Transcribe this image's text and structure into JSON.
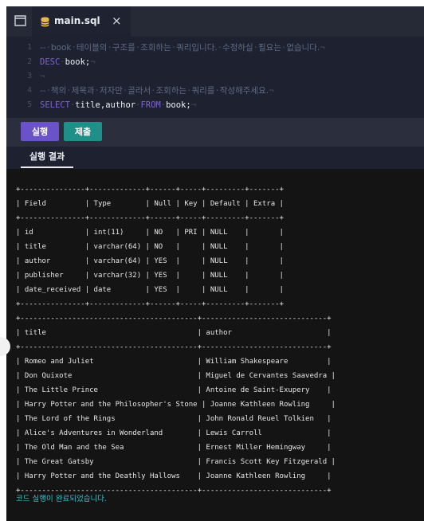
{
  "tab": {
    "filename": "main.sql",
    "close_glyph": "×"
  },
  "icons": {
    "files": "files-icon",
    "database": "database-icon",
    "close": "close-icon"
  },
  "editor": {
    "lines": [
      {
        "num": "1",
        "parts": [
          {
            "t": "--",
            "c": "cm"
          },
          {
            "t": "·",
            "c": "ws"
          },
          {
            "t": "book",
            "c": "cm"
          },
          {
            "t": "·",
            "c": "ws"
          },
          {
            "t": "테이블의",
            "c": "cm"
          },
          {
            "t": "·",
            "c": "ws"
          },
          {
            "t": "구조를",
            "c": "cm"
          },
          {
            "t": "·",
            "c": "ws"
          },
          {
            "t": "조회하는",
            "c": "cm"
          },
          {
            "t": "·",
            "c": "ws"
          },
          {
            "t": "쿼리입니다.",
            "c": "cm"
          },
          {
            "t": "·",
            "c": "ws"
          },
          {
            "t": "수정하실",
            "c": "cm"
          },
          {
            "t": "·",
            "c": "ws"
          },
          {
            "t": "필요는",
            "c": "cm"
          },
          {
            "t": "·",
            "c": "ws"
          },
          {
            "t": "없습니다.",
            "c": "cm"
          },
          {
            "t": "¬",
            "c": "ws"
          }
        ]
      },
      {
        "num": "2",
        "parts": [
          {
            "t": "DESC",
            "c": "kw"
          },
          {
            "t": "·",
            "c": "ws"
          },
          {
            "t": "book;",
            "c": "id"
          },
          {
            "t": "¬",
            "c": "ws"
          }
        ]
      },
      {
        "num": "3",
        "parts": [
          {
            "t": "¬",
            "c": "ws"
          }
        ]
      },
      {
        "num": "4",
        "parts": [
          {
            "t": "--",
            "c": "cm"
          },
          {
            "t": "·",
            "c": "ws"
          },
          {
            "t": "책의",
            "c": "cm"
          },
          {
            "t": "·",
            "c": "ws"
          },
          {
            "t": "제목과",
            "c": "cm"
          },
          {
            "t": "·",
            "c": "ws"
          },
          {
            "t": "저자만",
            "c": "cm"
          },
          {
            "t": "·",
            "c": "ws"
          },
          {
            "t": "골라서",
            "c": "cm"
          },
          {
            "t": "·",
            "c": "ws"
          },
          {
            "t": "조회하는",
            "c": "cm"
          },
          {
            "t": "·",
            "c": "ws"
          },
          {
            "t": "쿼리를",
            "c": "cm"
          },
          {
            "t": "·",
            "c": "ws"
          },
          {
            "t": "작성해주세요.",
            "c": "cm"
          },
          {
            "t": "¬",
            "c": "ws"
          }
        ]
      },
      {
        "num": "5",
        "parts": [
          {
            "t": "SELECT",
            "c": "kw"
          },
          {
            "t": "·",
            "c": "ws"
          },
          {
            "t": "title,author",
            "c": "id"
          },
          {
            "t": "·",
            "c": "ws"
          },
          {
            "t": "FROM",
            "c": "kw"
          },
          {
            "t": "·",
            "c": "ws"
          },
          {
            "t": "book;",
            "c": "id"
          },
          {
            "t": "¬",
            "c": "ws"
          }
        ]
      }
    ]
  },
  "toolbar": {
    "run_label": "실행",
    "submit_label": "제출"
  },
  "result": {
    "tab_label": "실행 결과"
  },
  "console": {
    "lines": [
      "+---------------+-------------+------+-----+---------+-------+",
      "| Field         | Type        | Null | Key | Default | Extra |",
      "+---------------+-------------+------+-----+---------+-------+",
      "| id            | int(11)     | NO   | PRI | NULL    |       |",
      "| title         | varchar(64) | NO   |     | NULL    |       |",
      "| author        | varchar(64) | YES  |     | NULL    |       |",
      "| publisher     | varchar(32) | YES  |     | NULL    |       |",
      "| date_received | date        | YES  |     | NULL    |       |",
      "+---------------+-------------+------+-----+---------+-------+",
      "+-----------------------------------------+-----------------------------+",
      "| title                                   | author                      |",
      "+-----------------------------------------+-----------------------------+",
      "| Romeo and Juliet                        | William Shakespeare         |",
      "| Don Quixote                             | Miguel de Cervantes Saavedra |",
      "| The Little Prince                       | Antoine de Saint-Exupery    |",
      "| Harry Potter and the Philosopher's Stone | Joanne Kathleen Rowling     |",
      "| The Lord of the Rings                   | John Ronald Reuel Tolkien   |",
      "| Alice's Adventures in Wonderland        | Lewis Carroll               |",
      "| The Old Man and the Sea                 | Ernest Miller Hemingway     |",
      "| The Great Gatsby                        | Francis Scott Key Fitzgerald |",
      "| Harry Potter and the Deathly Hallows    | Joanne Kathleen Rowling     |",
      "+-----------------------------------------+-----------------------------+"
    ],
    "status": "코드 실행이 완료되었습니다."
  },
  "colors": {
    "editor_bg": "#1e2130",
    "tabbar_bg": "#262a37",
    "toolbar_bg": "#2a2e3d",
    "console_bg": "#141414",
    "run_button": "#6a52c8",
    "submit_button": "#1f8f8a",
    "keyword": "#7e62d6",
    "comment": "#5e6a83",
    "status_text": "#33c1c6"
  }
}
